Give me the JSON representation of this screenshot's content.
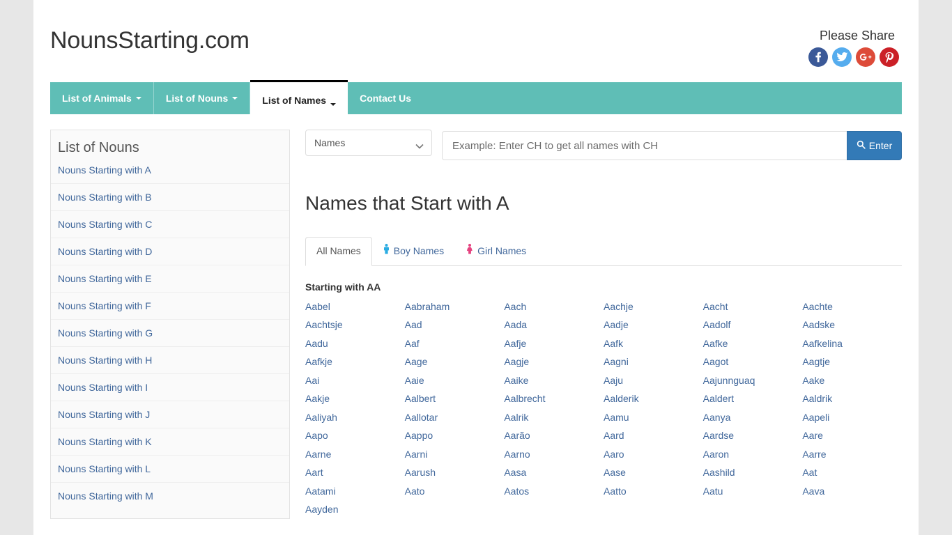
{
  "site": {
    "brand": "NounsStarting.com",
    "share_title": "Please Share",
    "share_icons": [
      {
        "name": "facebook-share-icon",
        "glyph": "f",
        "color": "#3b5998"
      },
      {
        "name": "twitter-share-icon",
        "glyph": "t",
        "color": "#55acee"
      },
      {
        "name": "google-plus-share-icon",
        "glyph": "G+",
        "color": "#dd4b39"
      },
      {
        "name": "pinterest-share-icon",
        "glyph": "P",
        "color": "#cb2027"
      }
    ],
    "accent_color": "#5fbeb6",
    "button_color": "#337ab7",
    "link_color": "#40679b"
  },
  "nav": {
    "items": [
      {
        "label": "List of Animals",
        "has_caret": true,
        "active": false
      },
      {
        "label": "List of Nouns",
        "has_caret": true,
        "active": false
      },
      {
        "label": "List of Names",
        "has_caret": true,
        "active": true
      },
      {
        "label": "Contact Us",
        "has_caret": false,
        "active": false
      }
    ]
  },
  "sidebar": {
    "title": "List of Nouns",
    "items": [
      {
        "label": "Nouns Starting with A"
      },
      {
        "label": "Nouns Starting with B"
      },
      {
        "label": "Nouns Starting with C"
      },
      {
        "label": "Nouns Starting with D"
      },
      {
        "label": "Nouns Starting with E"
      },
      {
        "label": "Nouns Starting with F"
      },
      {
        "label": "Nouns Starting with G"
      },
      {
        "label": "Nouns Starting with H"
      },
      {
        "label": "Nouns Starting with I"
      },
      {
        "label": "Nouns Starting with J"
      },
      {
        "label": "Nouns Starting with K"
      },
      {
        "label": "Nouns Starting with L"
      },
      {
        "label": "Nouns Starting with M"
      }
    ]
  },
  "search": {
    "select_value": "Names",
    "select_options": [
      "Names"
    ],
    "placeholder": "Example: Enter CH to get all names with CH",
    "input_value": "",
    "button_label": "Enter",
    "button_icon": "search-icon"
  },
  "main": {
    "title": "Names that Start with A",
    "tabs": [
      {
        "label": "All Names",
        "icon": null,
        "active": true
      },
      {
        "label": "Boy Names",
        "icon": "boy-icon",
        "icon_color": "#2bace2",
        "active": false
      },
      {
        "label": "Girl Names",
        "icon": "girl-icon",
        "icon_color": "#e5427f",
        "active": false
      }
    ],
    "group_heading": "Starting with AA",
    "names": [
      "Aabel",
      "Aabraham",
      "Aach",
      "Aachje",
      "Aacht",
      "Aachte",
      "Aachtsje",
      "Aad",
      "Aada",
      "Aadje",
      "Aadolf",
      "Aadske",
      "Aadu",
      "Aaf",
      "Aafje",
      "Aafk",
      "Aafke",
      "Aafkelina",
      "Aafkje",
      "Aage",
      "Aagje",
      "Aagni",
      "Aagot",
      "Aagtje",
      "Aai",
      "Aaie",
      "Aaike",
      "Aaju",
      "Aajunnguaq",
      "Aake",
      "Aakje",
      "Aalbert",
      "Aalbrecht",
      "Aalderik",
      "Aaldert",
      "Aaldrik",
      "Aaliyah",
      "Aallotar",
      "Aalrik",
      "Aamu",
      "Aanya",
      "Aapeli",
      "Aapo",
      "Aappo",
      "Aarão",
      "Aard",
      "Aardse",
      "Aare",
      "Aarne",
      "Aarni",
      "Aarno",
      "Aaro",
      "Aaron",
      "Aarre",
      "Aart",
      "Aarush",
      "Aasa",
      "Aase",
      "Aashild",
      "Aat",
      "Aatami",
      "Aato",
      "Aatos",
      "Aatto",
      "Aatu",
      "Aava",
      "Aayden"
    ]
  }
}
